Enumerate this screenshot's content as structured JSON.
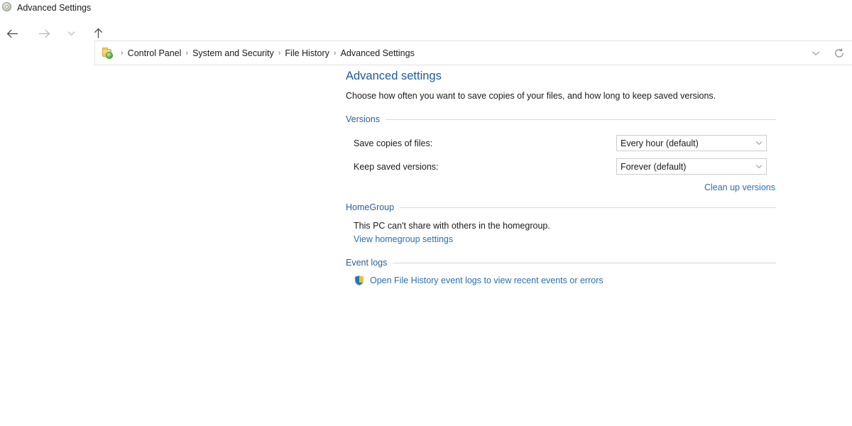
{
  "window": {
    "title": "Advanced Settings",
    "icon": "file-history-icon"
  },
  "nav": {
    "back_label": "Back",
    "forward_label": "Forward",
    "recent_label": "Recent locations",
    "up_label": "Up one level",
    "address_icon": "control-panel-folder-icon",
    "dropdown_label": "Previous locations",
    "refresh_label": "Refresh",
    "breadcrumbs": [
      {
        "label": "Control Panel"
      },
      {
        "label": "System and Security"
      },
      {
        "label": "File History"
      },
      {
        "label": "Advanced Settings"
      }
    ],
    "separator": "›"
  },
  "main": {
    "title": "Advanced settings",
    "description": "Choose how often you want to save copies of your files, and how long to keep saved versions.",
    "versions": {
      "group_title": "Versions",
      "fields": [
        {
          "label": "Save copies of files:",
          "value": "Every hour (default)"
        },
        {
          "label": "Keep saved versions:",
          "value": "Forever (default)"
        }
      ],
      "cleanup_link": "Clean up versions"
    },
    "homegroup": {
      "group_title": "HomeGroup",
      "text": "This PC can't share with others in the homegroup.",
      "link": "View homegroup settings"
    },
    "event_logs": {
      "group_title": "Event logs",
      "shield_icon": "uac-shield-icon",
      "link": "Open File History event logs to view recent events or errors"
    }
  },
  "colors": {
    "heading_blue": "#1b5a9e",
    "group_blue": "#2a6099",
    "link_blue": "#2b6fb0",
    "border_gray": "#d7d7d7",
    "text": "#1b1b1b"
  }
}
